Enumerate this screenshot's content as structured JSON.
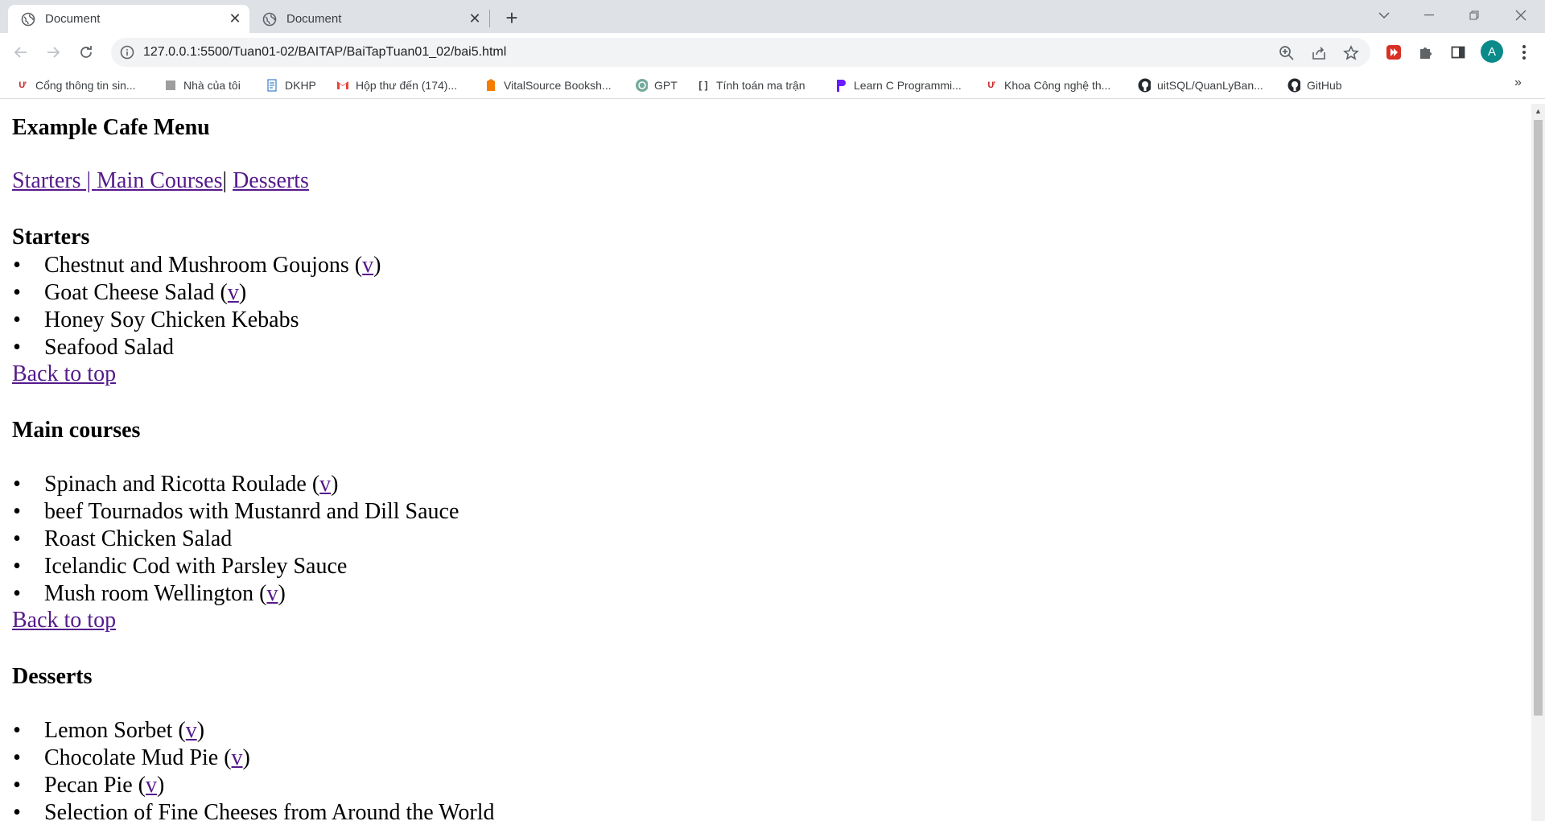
{
  "tabs": [
    {
      "label": "Document",
      "active": true
    },
    {
      "label": "Document",
      "active": false
    }
  ],
  "address_bar": {
    "url": "127.0.0.1:5500/Tuan01-02/BAITAP/BaiTapTuan01_02/bai5.html"
  },
  "avatar_letter": "A",
  "bookmarks": [
    {
      "label": "Cổng thông tin sin...",
      "icon": "uit-logo-icon"
    },
    {
      "label": "Nhà của tôi",
      "icon": "home-page-icon"
    },
    {
      "label": "DKHP",
      "icon": "document-icon"
    },
    {
      "label": "Hộp thư đến (174)...",
      "icon": "gmail-icon"
    },
    {
      "label": "VitalSource Booksh...",
      "icon": "vitalsource-icon"
    },
    {
      "label": "GPT",
      "icon": "openai-icon"
    },
    {
      "label": "Tính toán ma trận",
      "icon": "matrix-icon"
    },
    {
      "label": "Learn C Programmi...",
      "icon": "programiz-icon"
    },
    {
      "label": "Khoa Công nghệ th...",
      "icon": "uit-logo-icon"
    },
    {
      "label": "uitSQL/QuanLyBan...",
      "icon": "github-icon"
    },
    {
      "label": "GitHub",
      "icon": "github-icon"
    }
  ],
  "page": {
    "title": "Example Cafe Menu",
    "nav": {
      "starters": "Starters | ",
      "main_courses": "Main Courses",
      "separator": "| ",
      "desserts": "Desserts"
    },
    "sections": [
      {
        "heading": "Starters",
        "items": [
          {
            "name": "Chestnut and Mushroom Goujons",
            "veg": "v"
          },
          {
            "name": "Goat Cheese Salad",
            "veg": "v"
          },
          {
            "name": "Honey Soy Chicken Kebabs",
            "veg": ""
          },
          {
            "name": "Seafood Salad",
            "veg": ""
          }
        ],
        "back_to_top": "Back to top"
      },
      {
        "heading": "Main courses",
        "items": [
          {
            "name": "Spinach and Ricotta Roulade",
            "veg": "v"
          },
          {
            "name": "beef Tournados with Mustanrd and Dill Sauce",
            "veg": ""
          },
          {
            "name": "Roast Chicken Salad",
            "veg": ""
          },
          {
            "name": "Icelandic Cod with Parsley Sauce",
            "veg": ""
          },
          {
            "name": "Mush room Wellington",
            "veg": "v"
          }
        ],
        "back_to_top": "Back to top"
      },
      {
        "heading": "Desserts",
        "items": [
          {
            "name": "Lemon Sorbet",
            "veg": "v"
          },
          {
            "name": "Chocolate Mud Pie",
            "veg": "v"
          },
          {
            "name": "Pecan Pie",
            "veg": "v"
          },
          {
            "name": "Selection of Fine Cheeses from Around the World",
            "veg": ""
          }
        ]
      }
    ]
  }
}
